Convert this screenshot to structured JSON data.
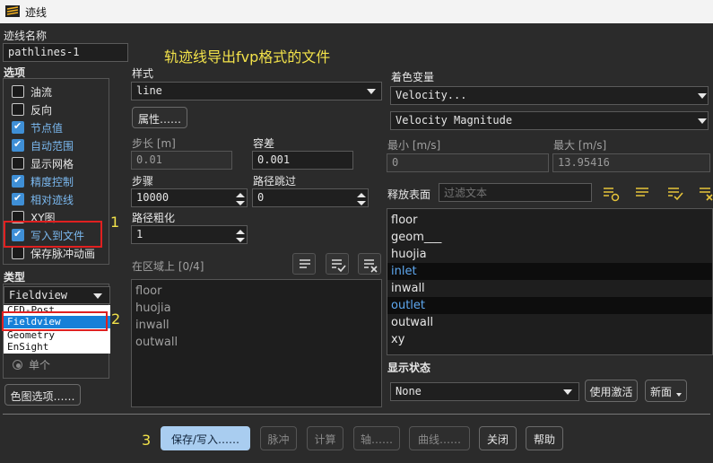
{
  "window": {
    "title": "迹线"
  },
  "annotation": {
    "headline": "轨迹线导出fvp格式的文件",
    "mark1": "1",
    "mark2": "2",
    "mark3": "3"
  },
  "pathline_name": {
    "label": "迹线名称",
    "value": "pathlines-1"
  },
  "options": {
    "heading": "选项",
    "items": [
      {
        "label": "油流",
        "checked": false
      },
      {
        "label": "反向",
        "checked": false
      },
      {
        "label": "节点值",
        "checked": true
      },
      {
        "label": "自动范围",
        "checked": true
      },
      {
        "label": "显示网格",
        "checked": false
      },
      {
        "label": "精度控制",
        "checked": true
      },
      {
        "label": "相对迹线",
        "checked": true
      },
      {
        "label": "XY图",
        "checked": false
      },
      {
        "label": "写入到文件",
        "checked": true
      },
      {
        "label": "保存脉冲动画",
        "checked": false
      }
    ]
  },
  "type": {
    "label": "类型",
    "selected": "Fieldview",
    "options": [
      "CFD-Post",
      "Fieldview",
      "Geometry",
      "EnSight"
    ],
    "radio_label": "单个"
  },
  "colormap_button": "色图选项……",
  "style": {
    "label": "样式",
    "value": "line",
    "attributes_button": "属性……"
  },
  "step_size": {
    "label": "步长 [m]",
    "value": "0.01"
  },
  "tolerance": {
    "label": "容差",
    "value": "0.001"
  },
  "steps": {
    "label": "步骤",
    "value": "10000"
  },
  "path_skip": {
    "label": "路径跳过",
    "value": "0"
  },
  "path_coarsen": {
    "label": "路径粗化",
    "value": "1"
  },
  "on_zone": {
    "label": "在区域上 [0/4]",
    "items": [
      "floor",
      "huojia",
      "inwall",
      "outwall"
    ]
  },
  "color_by": {
    "label": "着色变量",
    "variable": "Velocity...",
    "component": "Velocity Magnitude",
    "min_label": "最小 [m/s]",
    "min_value": "0",
    "max_label": "最大 [m/s]",
    "max_value": "13.95416"
  },
  "release": {
    "label": "释放表面",
    "filter_placeholder": "过滤文本",
    "items": [
      {
        "name": "floor",
        "selected": false
      },
      {
        "name": "geom___",
        "selected": false
      },
      {
        "name": "huojia",
        "selected": false
      },
      {
        "name": "inlet",
        "selected": true
      },
      {
        "name": "inwall",
        "selected": false
      },
      {
        "name": "outlet",
        "selected": true
      },
      {
        "name": "outwall",
        "selected": false
      },
      {
        "name": "xy",
        "selected": false
      }
    ]
  },
  "display_state": {
    "label": "显示状态",
    "value": "None",
    "use_active": "使用激活",
    "new": "新面"
  },
  "footer": {
    "save": "保存/写入……",
    "pulse": "脉冲",
    "compute": "计算",
    "axis": "轴……",
    "curve": "曲线……",
    "close": "关闭",
    "help": "帮助"
  },
  "colors": {
    "accent": "#3f8fd6",
    "annotation": "#f2e24a",
    "highlight_box": "#e02020",
    "primary_button": "#a9cdf0"
  }
}
